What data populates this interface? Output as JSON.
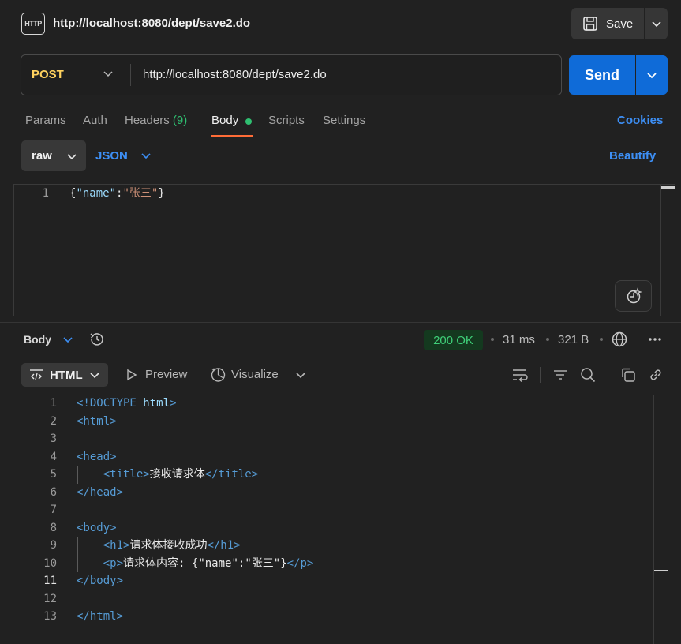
{
  "header": {
    "badge": "HTTP",
    "title": "http://localhost:8080/dept/save2.do",
    "save_label": "Save"
  },
  "request": {
    "method": "POST",
    "url": "http://localhost:8080/dept/save2.do",
    "send_label": "Send"
  },
  "tabs": [
    {
      "label": "Params"
    },
    {
      "label": "Auth"
    },
    {
      "label": "Headers"
    },
    {
      "label": "Body"
    },
    {
      "label": "Scripts"
    },
    {
      "label": "Settings"
    }
  ],
  "headers_count": "(9)",
  "cookies_label": "Cookies",
  "body_mode": "raw",
  "body_format": "JSON",
  "beautify_label": "Beautify",
  "request_body": {
    "line_number": "1",
    "code": "{\"name\":\"张三\"}"
  },
  "response": {
    "body_label": "Body",
    "status": "200 OK",
    "time": "31 ms",
    "size": "321 B",
    "view_mode": "HTML",
    "preview_label": "Preview",
    "visualize_label": "Visualize",
    "lines": [
      {
        "n": "1",
        "code": "<!DOCTYPE html>"
      },
      {
        "n": "2",
        "code": "<html>"
      },
      {
        "n": "3",
        "code": ""
      },
      {
        "n": "4",
        "code": "<head>"
      },
      {
        "n": "5",
        "code": "    <title>接收请求体</title>"
      },
      {
        "n": "6",
        "code": "</head>"
      },
      {
        "n": "7",
        "code": ""
      },
      {
        "n": "8",
        "code": "<body>"
      },
      {
        "n": "9",
        "code": "    <h1>请求体接收成功</h1>"
      },
      {
        "n": "10",
        "code": "    <p>请求体内容: {\"name\":\"张三\"}</p>"
      },
      {
        "n": "11",
        "code": "</body>"
      },
      {
        "n": "12",
        "code": ""
      },
      {
        "n": "13",
        "code": "</html>"
      }
    ]
  },
  "colors": {
    "accent": "#0f6bd8",
    "link": "#3d8ff5",
    "method": "#ffd25e",
    "status_ok": "#3fd079",
    "tab_active": "#ff6c37"
  }
}
